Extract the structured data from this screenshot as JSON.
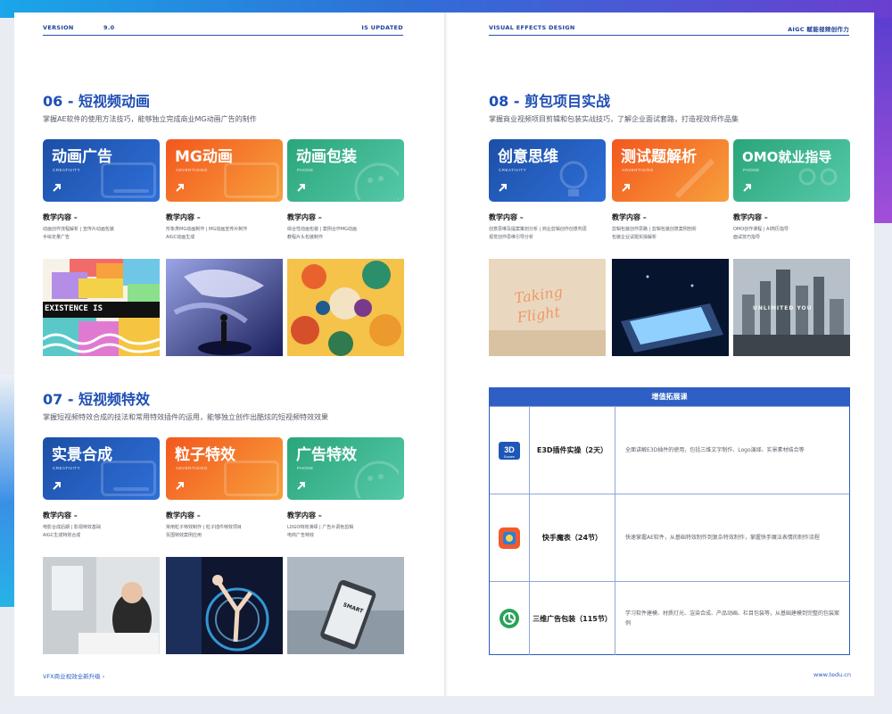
{
  "header": {
    "left": {
      "version": "VERSION",
      "number": "9.0",
      "status": "IS UPDATED"
    },
    "right": {
      "title": "VISUAL EFFECTS DESIGN",
      "tag": "AIGC 赋能视频创作力"
    }
  },
  "sections": {
    "s06": {
      "title": "06 - 短视频动画",
      "desc": "掌握AE软件的使用方法技巧，能够独立完成商业MG动画广告的制作",
      "cards": [
        {
          "title": "动画广告",
          "sub": "CREATIVITY",
          "teach_h": "教学内容 –",
          "teach_d": "动画创作流程解析 | 宣传片动画包装\n手绘定量广告"
        },
        {
          "title": "MG动画",
          "sub": "ADVERTISING",
          "teach_h": "教学内容 –",
          "teach_d": "形象类MG动画制作 | MG动画宣传片制作\nAIGC动画生成"
        },
        {
          "title": "动画包装",
          "sub": "PHONE",
          "teach_h": "教学内容 –",
          "teach_d": "综合性动画包装 | 案例合作MG动画\n教程片头包装制作"
        }
      ],
      "photo_text": "EXISTENCE IS"
    },
    "s07": {
      "title": "07 - 短视频特效",
      "desc": "掌握短视频特效合成的技法和常用特效插件的运用，能够独立创作出酷炫的短视频特效效果",
      "cards": [
        {
          "title": "实景合成",
          "sub": "CREATIVITY",
          "teach_h": "教学内容 –",
          "teach_d": "电影合成后期 | 影视特效基础\nAIGC生成特效合成"
        },
        {
          "title": "粒子特效",
          "sub": "ADVERTISING",
          "teach_h": "教学内容 –",
          "teach_d": "常用粒子特效制作 | 粒子插件特效项目\n氛围特效案例应用"
        },
        {
          "title": "广告特效",
          "sub": "PHONE",
          "teach_h": "教学内容 –",
          "teach_d": "LOGO特效演绎 | 广告片调色剪辑\n电商广告特效"
        }
      ],
      "photo_text": "SMART"
    },
    "s08": {
      "title": "08 - 剪包项目实战",
      "desc": "掌握商业视频项目剪辑和包装实战技巧，了解企业面试套路，打造视效师作品集",
      "cards": [
        {
          "title": "创意思维",
          "sub": "CREATIVITY",
          "teach_h": "教学内容 –",
          "teach_d": "创意思维及提案策划分析 | 商业剪辑创作创意构思\n视觉创作思维引导分析"
        },
        {
          "title": "测试题解析",
          "sub": "ADVERTISING",
          "teach_h": "教学内容 –",
          "teach_d": "剪辑包装创作思路 | 剪辑包装创意案例剖析\n包装企业试题实操解析"
        },
        {
          "title": "OMO就业指导",
          "sub": "PHONE",
          "teach_h": "教学内容 –",
          "teach_d": "OMO创作课程 | AI简历指导\n面试技巧指导"
        }
      ],
      "photo_text": "Taking Flight",
      "photo_text2": "UNLIMITED YOU"
    }
  },
  "table": {
    "title": "增值拓展课",
    "rows": [
      {
        "name": "E3D插件实操（2天）",
        "desc": "全面讲解E3D插件的使用，包括三维文字制作、Logo演绎、实景素材结合等"
      },
      {
        "name": "快手魔表（24节）",
        "desc": "快速掌握AE软件，从基础特效制作到复杂特效制作，掌握快手魔法表情的制作流程"
      },
      {
        "name": "三维广告包装（115节）",
        "desc": "学习软件建模、材质灯光、渲染合成、产品动画、栏目包装等，从基础建模到完整的包装案例"
      }
    ],
    "icons": [
      "e3d-icon",
      "kuaishou-icon",
      "c4d-icon"
    ],
    "e3d_logo_text": "3D",
    "e3d_logo_sub": "Ecosee"
  },
  "footer": {
    "left": "VFX商业视效全新升级 ›",
    "right": "www.tedu.cn"
  },
  "colors": {
    "accent": "#1f4fb5",
    "card_blue": "#2f6fd8",
    "card_orange": "#f3571e",
    "card_green": "#2aa57a"
  }
}
